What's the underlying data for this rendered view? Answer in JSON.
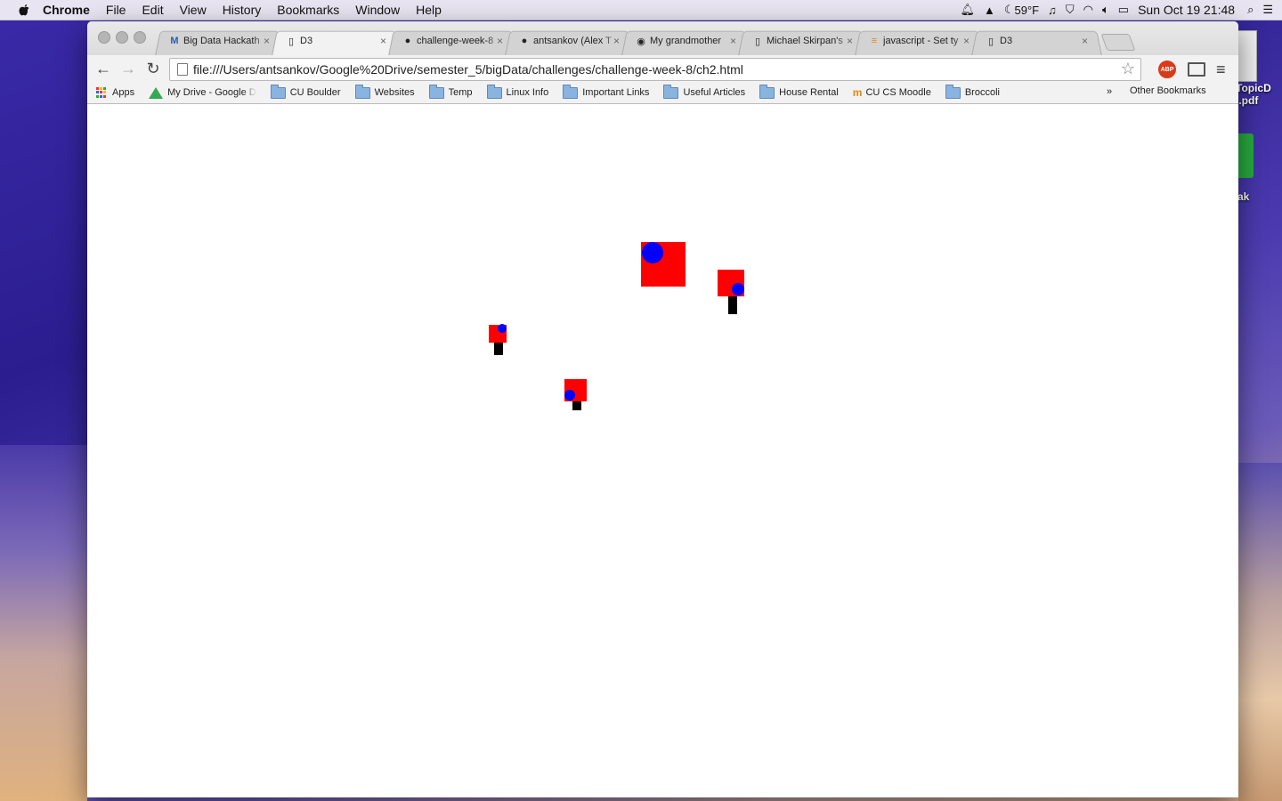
{
  "menubar": {
    "app_name": "Chrome",
    "menus": [
      "File",
      "Edit",
      "View",
      "History",
      "Bookmarks",
      "Window",
      "Help"
    ],
    "weather": "59°F",
    "clock": "Sun Oct 19  21:48"
  },
  "desktop": {
    "file_label_line1": "TopicD",
    "file_label_line2": "l.pdf",
    "partial_label": "ak"
  },
  "tabs": [
    {
      "title": "Big Data Hackath",
      "favicon": "M",
      "active": false
    },
    {
      "title": "D3",
      "favicon": "page",
      "active": true
    },
    {
      "title": "challenge-week-8",
      "favicon": "github",
      "active": false
    },
    {
      "title": "antsankov (Alex T",
      "favicon": "github",
      "active": false
    },
    {
      "title": "My grandmother",
      "favicon": "reddit",
      "active": false
    },
    {
      "title": "Michael Skirpan's",
      "favicon": "page",
      "active": false
    },
    {
      "title": "javascript - Set ty",
      "favicon": "stackoverflow",
      "active": false
    },
    {
      "title": "D3",
      "favicon": "page",
      "active": false
    }
  ],
  "omnibox": {
    "url": "file:///Users/antsankov/Google%20Drive/semester_5/bigData/challenges/challenge-week-8/ch2.html"
  },
  "extensions": {
    "abp_label": "ABP"
  },
  "bookmarks": {
    "items": [
      {
        "label": "Apps",
        "icon": "apps"
      },
      {
        "label": "My Drive - Google D",
        "icon": "drive"
      },
      {
        "label": "CU Boulder",
        "icon": "folder"
      },
      {
        "label": "Websites",
        "icon": "folder"
      },
      {
        "label": "Temp",
        "icon": "folder"
      },
      {
        "label": "Linux Info",
        "icon": "folder"
      },
      {
        "label": "Important Links",
        "icon": "folder"
      },
      {
        "label": "Useful Articles",
        "icon": "folder"
      },
      {
        "label": "House Rental",
        "icon": "folder"
      },
      {
        "label": "CU CS Moodle",
        "icon": "moodle"
      },
      {
        "label": "Broccoli",
        "icon": "folder"
      }
    ],
    "overflow": "»",
    "other": "Other Bookmarks"
  },
  "page": {
    "colors": {
      "square": "#ff0000",
      "circle": "#0000ff",
      "bar": "#000000"
    }
  }
}
